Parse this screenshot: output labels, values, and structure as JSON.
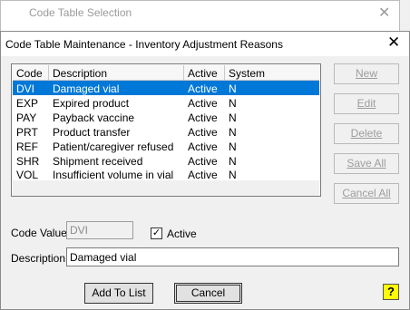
{
  "bg_window": {
    "title": "Code Table Selection",
    "close_glyph": "✕"
  },
  "dialog": {
    "title": "Code Table Maintenance - Inventory Adjustment Reasons",
    "close_glyph": "✕"
  },
  "list": {
    "columns": [
      "Code",
      "Description",
      "Active",
      "System"
    ],
    "rows": [
      {
        "code": "DVI",
        "description": "Damaged vial",
        "active": "Active",
        "system": "N",
        "selected": true
      },
      {
        "code": "EXP",
        "description": "Expired product",
        "active": "Active",
        "system": "N"
      },
      {
        "code": "PAY",
        "description": "Payback vaccine",
        "active": "Active",
        "system": "N"
      },
      {
        "code": "PRT",
        "description": "Product transfer",
        "active": "Active",
        "system": "N"
      },
      {
        "code": "REF",
        "description": "Patient/caregiver refused",
        "active": "Active",
        "system": "N"
      },
      {
        "code": "SHR",
        "description": "Shipment received",
        "active": "Active",
        "system": "N"
      },
      {
        "code": "VOL",
        "description": "Insufficient volume in vial",
        "active": "Active",
        "system": "N"
      }
    ]
  },
  "side_buttons": {
    "new": "New",
    "edit": "Edit",
    "delete": "Delete",
    "save_all": "Save All",
    "cancel_all": "Cancel All"
  },
  "form": {
    "code_value_label": "Code Value:",
    "code_value": "DVI",
    "active_label": "Active",
    "active_checked": "✓",
    "description_label": "Description:",
    "description_value": "Damaged vial"
  },
  "buttons": {
    "add_to_list": "Add To List",
    "cancel": "Cancel",
    "help": "?"
  },
  "colors": {
    "selection": "#0078d7",
    "help_bg": "#ffff00"
  }
}
